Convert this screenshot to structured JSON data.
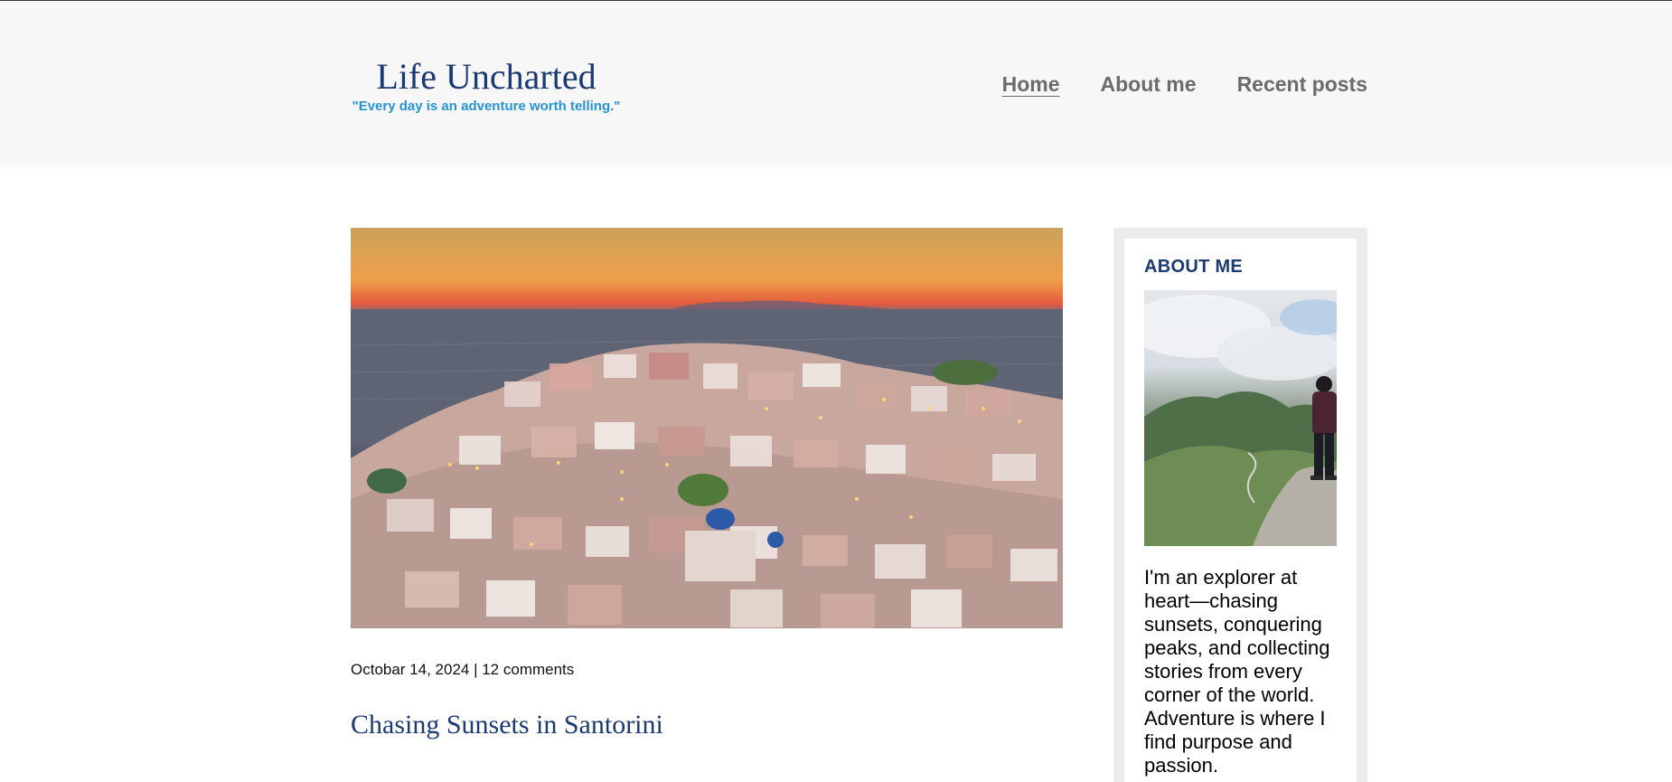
{
  "site": {
    "title": "Life Uncharted",
    "tagline": "\"Every day is an adventure worth telling.\""
  },
  "nav": {
    "items": [
      {
        "label": "Home",
        "active": true
      },
      {
        "label": "About me",
        "active": false
      },
      {
        "label": "Recent posts",
        "active": false
      }
    ]
  },
  "post": {
    "meta": "Octobar 14, 2024 | 12 comments",
    "title": "Chasing Sunsets in Santorini"
  },
  "sidebar": {
    "heading": "ABOUT ME",
    "text": "I'm an explorer at heart—chasing sunsets, conquering peaks, and collecting stories from every corner of the world. Adventure is where I find purpose and passion."
  },
  "colors": {
    "brand": "#1b3a73",
    "tagline": "#2793d4",
    "nav": "#6b6b6b",
    "header_bg": "#f7f7f7",
    "sidebar_frame": "#ebebeb"
  }
}
